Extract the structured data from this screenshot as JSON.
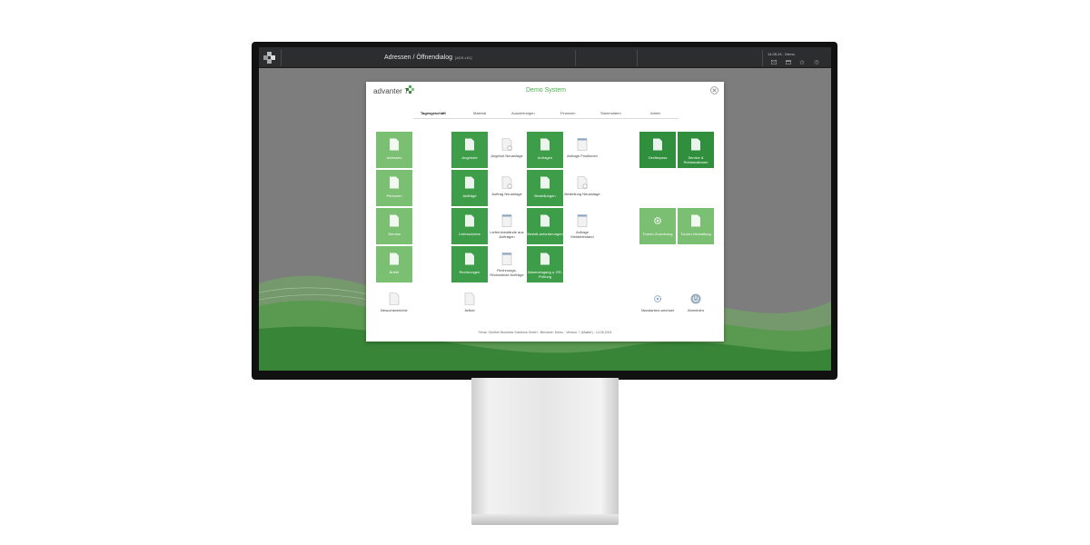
{
  "topbar": {
    "title": "Adressen / Öffnendialog",
    "code": "[ADS-L61]",
    "user": "14.05.24 - Demo"
  },
  "dialog": {
    "brand": "advanter 7",
    "system": "Demo System",
    "tabs": [
      "Tagesgeschäft",
      "Material",
      "Auswertungen",
      "Finanzen",
      "Stammdaten",
      "Admin"
    ],
    "tiles": {
      "adressen": "Adressen",
      "personen": "Personen",
      "termine": "Termine",
      "briefe": "Briefe",
      "besuchsberichte": "Besuchsberichte",
      "angebote": "Angebote",
      "angebot_neuanlage": "Angebot Neuanlage",
      "auftraege": "Aufträge",
      "auftrag_neuanlage": "Auftrag Neuanlage",
      "lieferscheine": "Lieferscheine",
      "lieferrueckstaende": "Lieferrückstände aus Aufträgen",
      "rechnungen": "Rechnungen",
      "rechnungsrueckstaende": "Rechnungs-Rückstände Aufträge",
      "artikel": "Artikel",
      "anfragen": "Anfragen",
      "anfrage_positionen": "Anfrage Positionen",
      "bestellungen": "Bestellungen",
      "bestellung_neuanlage": "Bestellung Neuanlage",
      "bestellanforderungen": "Bestell-anforderungen",
      "anfrage_meldebestand": "Anfrage Meldebestand",
      "wareneingang": "Wareneingang u. ER-Prüfung",
      "geraetepass": "Gerätepass",
      "service": "Service & Reklamationen",
      "touren_zuordnung": "Touren-Zuordnung",
      "touren_verwaltung": "Touren-Verwaltung",
      "mandantenwechsel": "Mandanten-wechsel",
      "abmelden": "Abmelden"
    },
    "footer": "Firma: Günther Business Solutions GmbH - Benutzer: Demo - Version: 7 (Master) - 14.05.2024"
  },
  "colors": {
    "dark_green": "#2f8f3c",
    "light_green": "#7bbf72",
    "accent": "#4caf50"
  },
  "icons": [
    "logo-icon",
    "document-icon",
    "new-document-icon",
    "list-icon",
    "gear-icon",
    "power-icon",
    "mail-icon",
    "calendar-icon",
    "star-icon",
    "help-icon",
    "close-icon"
  ]
}
